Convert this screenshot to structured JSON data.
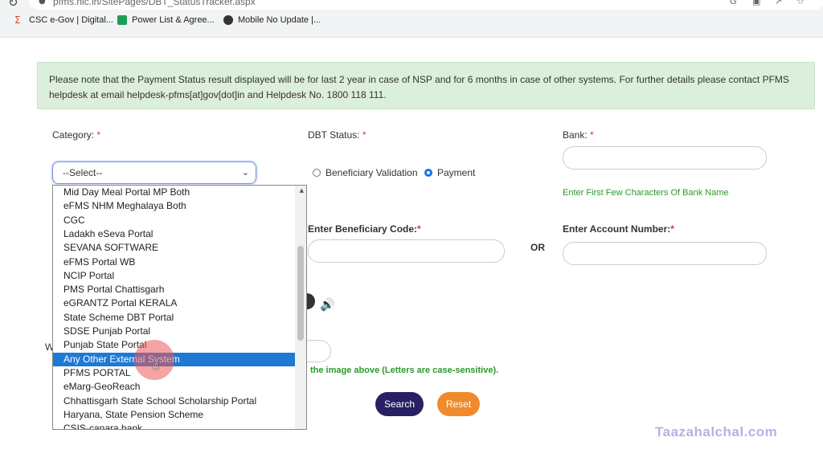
{
  "browser": {
    "url": "pfms.nic.in/SitePages/DBT_StatusTracker.aspx",
    "bookmarks": [
      {
        "label": "CSC e-Gov | Digital...",
        "icon": "csc-icon"
      },
      {
        "label": "Power List & Agree...",
        "icon": "sheet-icon"
      },
      {
        "label": "Mobile No Update |...",
        "icon": "globe-icon"
      }
    ]
  },
  "notice": {
    "text": "Please note that the Payment Status result displayed will be for last 2 year in case of NSP and for 6 months in case of other systems. For further details please contact PFMS helpdesk at email helpdesk-pfms[at]gov[dot]in and Helpdesk No. 1800 118 111."
  },
  "form": {
    "category_label": "Category:",
    "required_mark": "*",
    "category_value": "--Select--",
    "dbt_status_label": "DBT Status:",
    "radio_beneficiary": "Beneficiary Validation",
    "radio_payment": "Payment",
    "selected_radio": "Payment",
    "bank_label": "Bank:",
    "bank_hint": "Enter First Few Characters Of Bank Name",
    "beneficiary_code_label": "Enter Beneficiary Code:",
    "or_text": "OR",
    "account_number_label": "Enter Account Number:",
    "captcha_hint": "the image above (Letters are case-sensitive).",
    "w_letter": "W",
    "search_label": "Search",
    "reset_label": "Reset"
  },
  "dropdown": {
    "selected": "Any Other External System",
    "options": [
      "Mid Day Meal Portal MP Both",
      "eFMS NHM Meghalaya Both",
      "CGC",
      "Ladakh eSeva Portal",
      "SEVANA SOFTWARE",
      "eFMS Portal WB",
      "NCIP Portal",
      "PMS Portal Chattisgarh",
      "eGRANTZ Portal KERALA",
      "State Scheme DBT Portal",
      "SDSE Punjab Portal",
      "Punjab State Portal",
      "Any Other External System",
      "PFMS PORTAL",
      "eMarg-GeoReach",
      "Chhattisgarh State School Scholarship Portal",
      "Haryana, State Pension Scheme",
      "CSIS-canara bank"
    ]
  },
  "colors": {
    "search_button": "#272163",
    "reset_button": "#f08a2c",
    "selected_option": "#1e79d4",
    "hint_green": "#2a9a2a"
  },
  "watermark": "Taazahalchal.com"
}
